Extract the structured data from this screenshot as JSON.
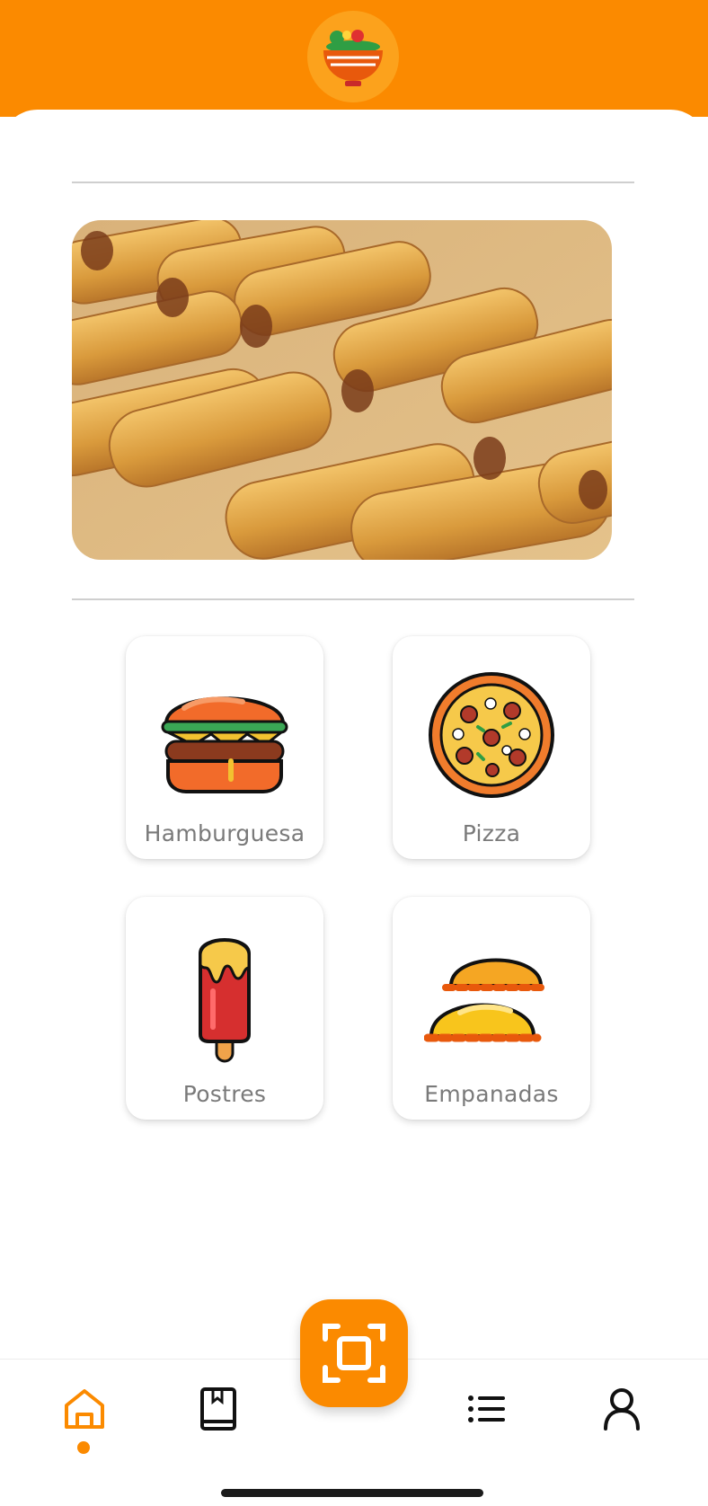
{
  "categories": [
    {
      "label": "Hamburguesa",
      "icon": "burger-icon"
    },
    {
      "label": "Pizza",
      "icon": "pizza-icon"
    },
    {
      "label": "Postres",
      "icon": "popsicle-icon"
    },
    {
      "label": "Empanadas",
      "icon": "empanada-icon"
    }
  ],
  "bottom_nav": [
    {
      "icon": "home-icon",
      "active": true
    },
    {
      "icon": "book-icon",
      "active": false
    },
    {
      "icon": "scan-icon",
      "active": false
    },
    {
      "icon": "list-icon",
      "active": false
    },
    {
      "icon": "user-icon",
      "active": false
    }
  ],
  "colors": {
    "brand": "#fb8a00",
    "text_muted": "#7a7a7a"
  }
}
